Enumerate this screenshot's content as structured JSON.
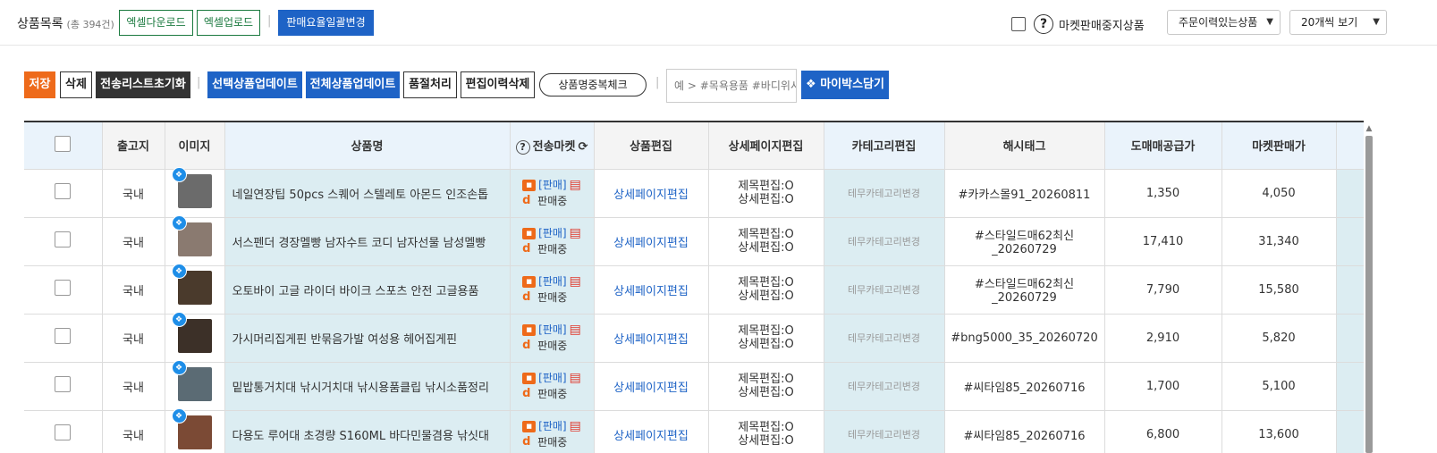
{
  "header": {
    "title": "상품목록",
    "count": "(총 394건)",
    "excel_download": "엑셀다운로드",
    "excel_upload": "엑셀업로드",
    "separator": "|",
    "bulk_margin": "판매요율일괄변경",
    "help_symbol": "?",
    "market_stopped_label": "마켓판매중지상품",
    "order_filter": "주문이력있는상품",
    "page_size": "20개씩 보기"
  },
  "toolbar": {
    "save": "저장",
    "delete": "삭제",
    "reset_send": "전송리스트초기화",
    "separator": "|",
    "update_selected": "선택상품업데이트",
    "update_all": "전체상품업데이트",
    "soldout": "품절처리",
    "delete_history": "편집이력삭제",
    "dup_check": "상품명중복체크",
    "hashtag_placeholder": "예 > #목욕용품 #바디위시",
    "mybox": "마이박스담기"
  },
  "table": {
    "columns": [
      "",
      "출고지",
      "이미지",
      "상품명",
      "전송마켓",
      "상품편집",
      "상세페이지편집",
      "카테고리편집",
      "해시태그",
      "도매매공급가",
      "마켓판매가"
    ],
    "market_help": "?",
    "refresh_symbol": "⟳",
    "market_badge": "[판매]",
    "market_status": "판매중",
    "detail_edit_label": "상세페이지편집",
    "title_edit": "제목편집:O",
    "detail_edit": "상세편집:O",
    "category_edit_label": "테무카테고리변경",
    "rows": [
      {
        "origin": "국내",
        "name": "네일연장팁 50pcs 스퀘어 스텔레토 아몬드 인조손톱",
        "hashtag": "#카카스몰91_20260811",
        "supply": "1,350",
        "price": "4,050",
        "thumb_color": "#6b6b6b"
      },
      {
        "origin": "국내",
        "name": "서스펜더 경장멜빵 남자수트 코디 남자선물 남성멜빵",
        "hashtag": "#스타일드매62최신_20260729",
        "supply": "17,410",
        "price": "31,340",
        "thumb_color": "#8a7a70"
      },
      {
        "origin": "국내",
        "name": "오토바이 고글 라이더 바이크 스포츠 안전 고글용품",
        "hashtag": "#스타일드매62최신_20260729",
        "supply": "7,790",
        "price": "15,580",
        "thumb_color": "#4a3a2c"
      },
      {
        "origin": "국내",
        "name": "가시머리집게핀 반묶음가발 여성용 헤어집게핀",
        "hashtag": "#bng5000_35_20260720",
        "supply": "2,910",
        "price": "5,820",
        "thumb_color": "#3c3028"
      },
      {
        "origin": "국내",
        "name": "밑밥통거치대 낚시거치대 낚시용품클립 낚시소품정리",
        "hashtag": "#씨타임85_20260716",
        "supply": "1,700",
        "price": "5,100",
        "thumb_color": "#5b6b74"
      },
      {
        "origin": "국내",
        "name": "다용도 루어대 초경량 S160ML 바다민물겸용 낚싯대",
        "hashtag": "#씨타임85_20260716",
        "supply": "6,800",
        "price": "13,600",
        "thumb_color": "#7b4a35"
      }
    ]
  }
}
